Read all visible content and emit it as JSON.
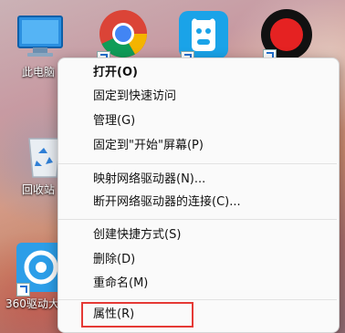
{
  "desktop": {
    "icons": [
      {
        "label": "此电脑",
        "icon": "this-pc-icon"
      },
      {
        "label": "",
        "icon": "chrome-icon"
      },
      {
        "label": "",
        "icon": "app-cow-icon"
      },
      {
        "label": "",
        "icon": "record-icon"
      },
      {
        "label": "回收站",
        "icon": "recycle-bin-icon"
      },
      {
        "label": "360驱动大师",
        "icon": "360-driver-icon"
      }
    ]
  },
  "context_menu": {
    "items": [
      {
        "label": "打开(O)"
      },
      {
        "label": "固定到快速访问"
      },
      {
        "label": "管理(G)"
      },
      {
        "label": "固定到\"开始\"屏幕(P)"
      },
      {
        "label": "映射网络驱动器(N)..."
      },
      {
        "label": "断开网络驱动器的连接(C)..."
      },
      {
        "label": "创建快捷方式(S)"
      },
      {
        "label": "删除(D)"
      },
      {
        "label": "重命名(M)"
      },
      {
        "label": "属性(R)"
      }
    ],
    "highlighted_item": "属性(R)",
    "highlight_color": "#e53935"
  }
}
